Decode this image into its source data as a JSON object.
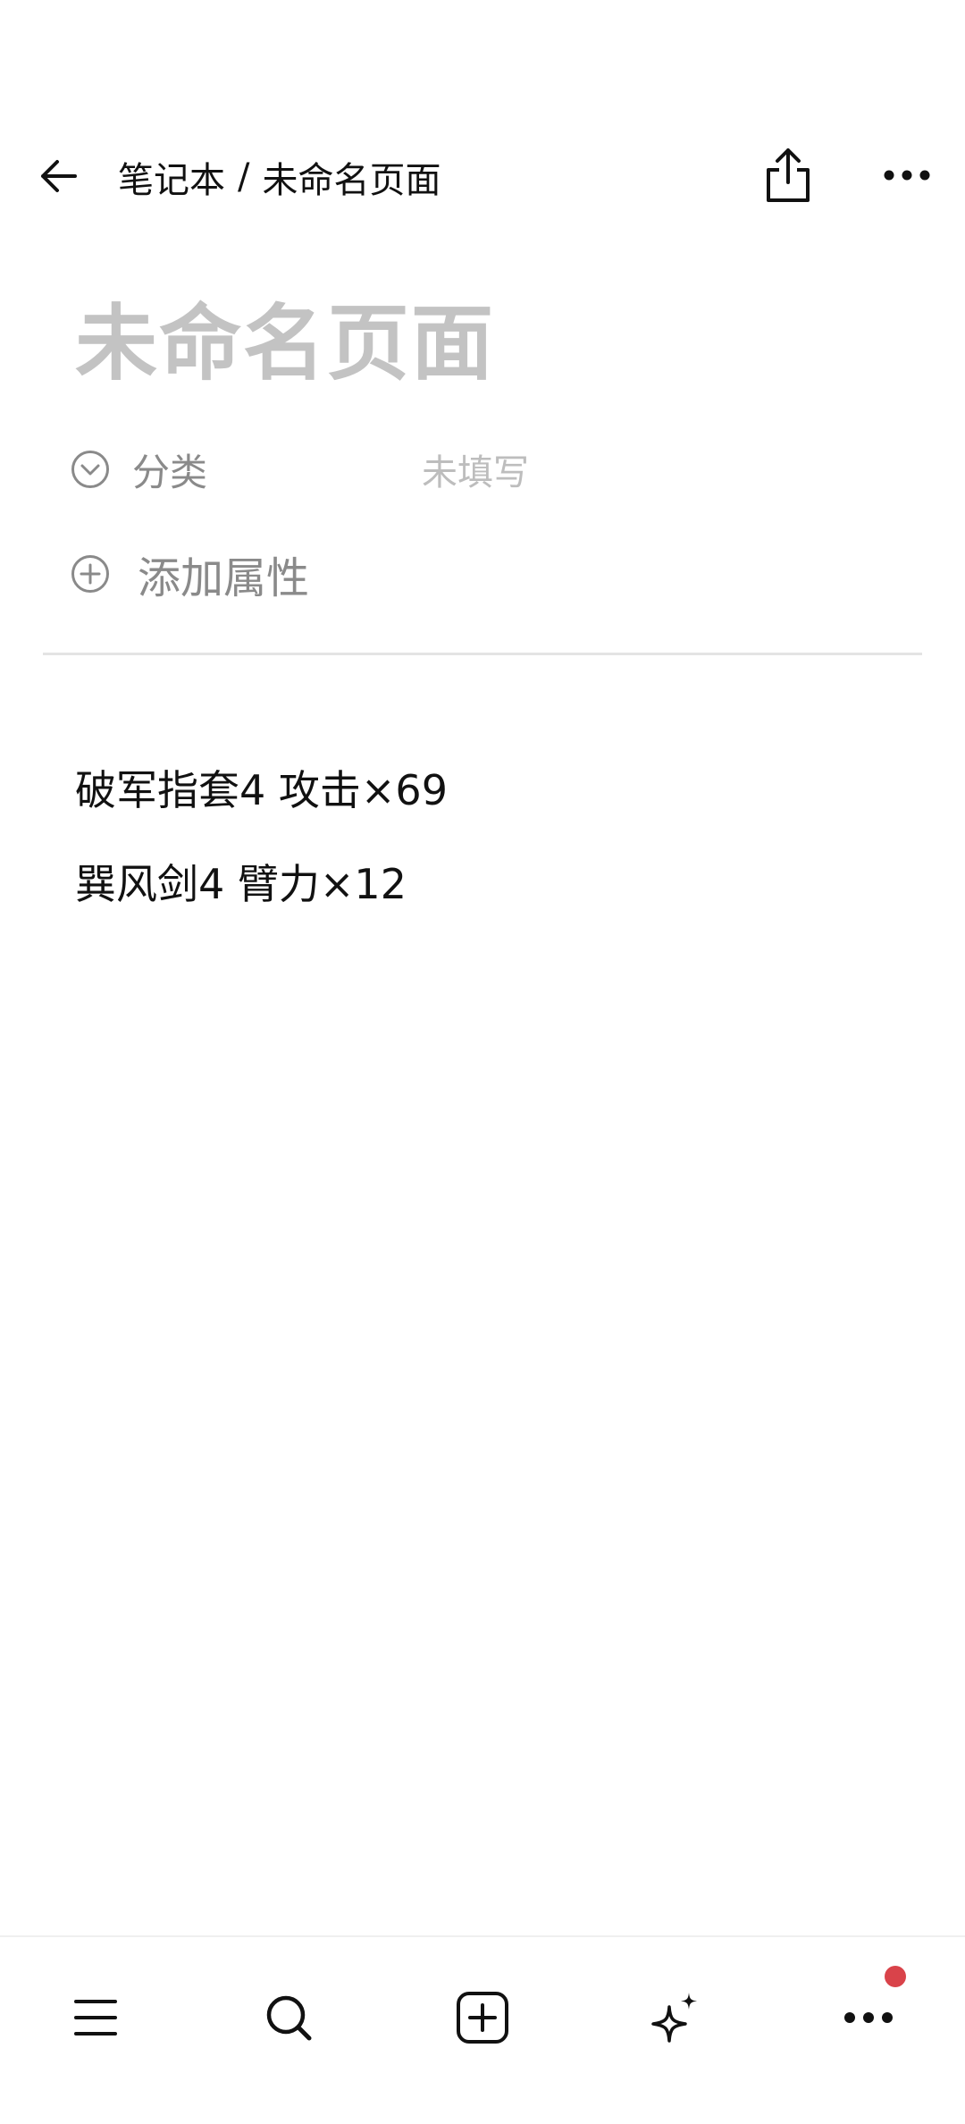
{
  "header": {
    "breadcrumb_parent": "笔记本",
    "breadcrumb_separator": "/",
    "breadcrumb_current": "未命名页面",
    "icons": [
      "back-arrow-icon",
      "share-icon",
      "more-horizontal-icon"
    ]
  },
  "page": {
    "title_placeholder": "未命名页面"
  },
  "properties": {
    "category_label": "分类",
    "category_value_placeholder": "未填写",
    "add_property_label": "添加属性"
  },
  "content": {
    "lines": [
      "破军指套4 攻击×69",
      "巽风剑4 臂力×12"
    ]
  },
  "bottom_nav": {
    "icons": [
      "menu-icon",
      "search-icon",
      "add-page-icon",
      "ai-sparkle-icon",
      "more-icon"
    ],
    "notification_badge_color": "#d9434a"
  },
  "colors": {
    "title_placeholder": "#c3c3c3",
    "muted_text": "#8a8a8a",
    "divider": "#e4e4e4"
  }
}
